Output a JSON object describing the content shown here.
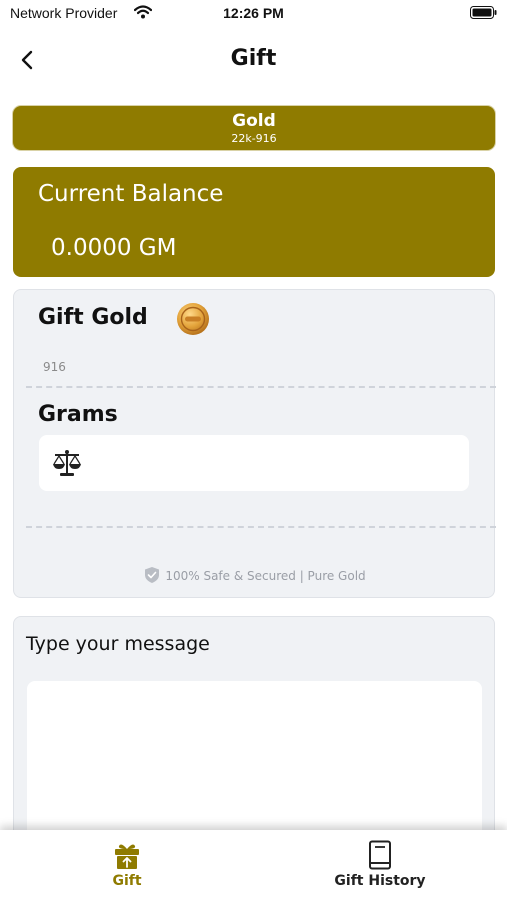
{
  "status_bar": {
    "carrier": "Network Provider",
    "time": "12:26 PM",
    "icons": [
      "wifi-icon",
      "battery-icon"
    ]
  },
  "header": {
    "title": "Gift",
    "back_icon": "chevron-left-icon"
  },
  "metal_tab": {
    "name": "Gold",
    "purity": "22k-916"
  },
  "balance": {
    "label": "Current Balance",
    "value": "0.0000 GM"
  },
  "gift_form": {
    "title": "Gift Gold",
    "coin_icon": "gold-coin-icon",
    "purity": "916",
    "grams_label": "Grams",
    "grams_icon": "scale-icon",
    "grams_value": "",
    "safe_text": "100% Safe & Secured | Pure Gold",
    "safe_icon": "shield-icon"
  },
  "message": {
    "label": "Type your message",
    "value": ""
  },
  "tab_bar": {
    "tabs": [
      {
        "label": "Gift",
        "icon": "gift-icon",
        "active": true
      },
      {
        "label": "Gift History",
        "icon": "book-icon",
        "active": false
      }
    ]
  },
  "colors": {
    "brand_gold": "#8f7b00",
    "card_bg": "#f0f2f5",
    "muted_text": "#9a9ea6"
  }
}
